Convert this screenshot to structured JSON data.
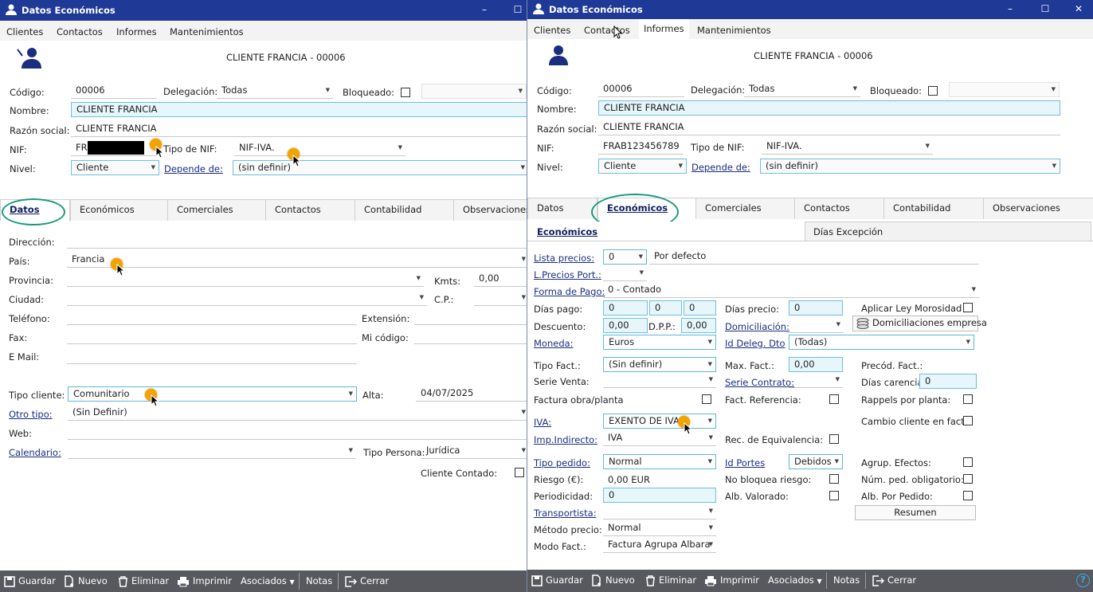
{
  "left": {
    "title": "Datos Económicos",
    "menu": [
      "Clientes",
      "Contactos",
      "Informes",
      "Mantenimientos"
    ],
    "header": "CLIENTE FRANCIA - 00006",
    "labels": {
      "codigo": "Código:",
      "delegacion": "Delegación:",
      "bloqueado": "Bloqueado:",
      "nombre": "Nombre:",
      "razon": "Razón social:",
      "nif": "NIF:",
      "tiponif": "Tipo de NIF:",
      "nivel": "Nivel:",
      "depende": "Depende de:"
    },
    "values": {
      "codigo": "00006",
      "delegacion": "Todas",
      "nombre": "CLIENTE FRANCIA",
      "razon": "CLIENTE FRANCIA",
      "nif": "FR",
      "tiponif": "NIF-IVA.",
      "nivel": "Cliente",
      "depende": "(sin definir)"
    },
    "tabs": [
      "Datos",
      "Económicos",
      "Comerciales",
      "Contactos",
      "Contabilidad",
      "Observaciones"
    ],
    "datos_labels": {
      "direccion": "Dirección:",
      "pais": "País:",
      "provincia": "Provincia:",
      "kmts": "Kmts:",
      "ciudad": "Ciudad:",
      "cp": "C.P.:",
      "telefono": "Teléfono:",
      "extension": "Extensión:",
      "fax": "Fax:",
      "micodigo": "Mi código:",
      "email": "E Mail:",
      "tipocliente": "Tipo cliente:",
      "alta": "Alta:",
      "otrotipo": "Otro tipo:",
      "web": "Web:",
      "calendario": "Calendario:",
      "tipopersona": "Tipo Persona:",
      "clientecontado": "Cliente Contado:"
    },
    "datos_values": {
      "pais": "Francia",
      "kmts": "0,00",
      "tipocliente": "Comunitario",
      "alta": "04/07/2025",
      "otrotipo": "(Sin Definir)",
      "tipopersona": "Jurídica"
    }
  },
  "right": {
    "title": "Datos Económicos",
    "menu": [
      "Clientes",
      "Contactos",
      "Informes",
      "Mantenimientos"
    ],
    "header": "CLIENTE FRANCIA - 00006",
    "values": {
      "codigo": "00006",
      "delegacion": "Todas",
      "nombre": "CLIENTE FRANCIA",
      "razon": "CLIENTE FRANCIA",
      "nif": "FRAB123456789",
      "tiponif": "NIF-IVA.",
      "nivel": "Cliente",
      "depende": "(sin definir)"
    },
    "subtabs": [
      "Económicos",
      "Días Excepción"
    ],
    "eco_labels": {
      "lista": "Lista precios:",
      "lprecios": "L.Precios Port.:",
      "forma": "Forma de Pago:",
      "diaspago": "Días pago:",
      "diasprecio": "Días precio:",
      "aplicar": "Aplicar Ley Morosidad",
      "descuento": "Descuento:",
      "dpp": "D.P.P.:",
      "domiciliacion": "Domiciliación:",
      "moneda": "Moneda:",
      "iddeleg": "Id Deleg. Dto",
      "tipofact": "Tipo Fact.:",
      "maxfact": "Max. Fact.:",
      "precod": "Precód. Fact.:",
      "serieventa": "Serie Venta:",
      "seriecontrato": "Serie Contrato:",
      "diascarencia": "Días carencia:",
      "facturaobra": "Factura obra/planta",
      "factref": "Fact. Referencia:",
      "rappels": "Rappels por planta:",
      "cambio": "Cambio cliente en fact.:",
      "iva": "IVA:",
      "impind": "Imp.Indirecto:",
      "receq": "Rec. de Equivalencia:",
      "tipopedido": "Tipo pedido:",
      "idportes": "Id Portes",
      "agrup": "Agrup. Efectos:",
      "riesgo": "Riesgo (€):",
      "nobloquea": "No bloquea riesgo:",
      "numped": "Núm. ped. obligatorio:",
      "periodicidad": "Periodicidad:",
      "albval": "Alb. Valorado:",
      "albped": "Alb. Por Pedido:",
      "transportista": "Transportista:",
      "metodo": "Método precio:",
      "modofact": "Modo Fact.:"
    },
    "eco_values": {
      "lista": "0",
      "lista_desc": "Por defecto",
      "forma": "0 - Contado",
      "dp1": "0",
      "dp2": "0",
      "dp3": "0",
      "diasprecio": "0",
      "descuento": "0,00",
      "dpp": "0,00",
      "domibtn": "Domiciliaciones empresa",
      "moneda": "Euros",
      "iddeleg": "(Todas)",
      "tipofact": "(Sin definir)",
      "maxfact": "0,00",
      "diascarencia": "0",
      "iva": "EXENTO DE IVA",
      "impind": "IVA",
      "tipopedido": "Normal",
      "idportes": "Debidos",
      "riesgo": "0,00 EUR",
      "periodicidad": "0",
      "metodo": "Normal",
      "modofact": "Factura Agrupa Albara",
      "resumen": "Resumen"
    }
  },
  "common_labels": {
    "codigo": "Código:",
    "delegacion": "Delegación:",
    "bloqueado": "Bloqueado:",
    "nombre": "Nombre:",
    "razon": "Razón social:",
    "nif": "NIF:",
    "tiponif": "Tipo de NIF:",
    "nivel": "Nivel:",
    "depende": "Depende de:"
  },
  "toolbar": {
    "guardar": "Guardar",
    "nuevo": "Nuevo",
    "eliminar": "Eliminar",
    "imprimir": "Imprimir",
    "asociados": "Asociados",
    "notas": "Notas",
    "cerrar": "Cerrar",
    "help": "?"
  },
  "icons": [
    "user-icon",
    "minimize-icon",
    "maximize-icon",
    "close-icon",
    "save-icon",
    "new-icon",
    "trash-icon",
    "print-icon",
    "exit-icon",
    "help-icon",
    "coins-icon",
    "chevron-down-icon"
  ]
}
